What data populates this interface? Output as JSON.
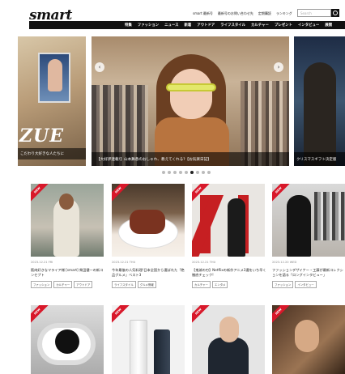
{
  "header": {
    "logo": "smart",
    "top_links": [
      "smart 最新号",
      "最新号のお問い合わせ先",
      "定期購読",
      "ランキング"
    ],
    "search_placeholder": "Search"
  },
  "nav": {
    "items": [
      "特集",
      "ファッション",
      "ニュース",
      "新着",
      "アウトドア",
      "ライフスタイル",
      "カルチャー",
      "プレゼント",
      "インタビュー",
      "展開"
    ]
  },
  "carousel": {
    "left_caption": "こだわり大好きな人たちに",
    "left_big_text": "ZUE",
    "main_caption": "【大好評連載!】山本舞香のおしゃれ、教えてくれる?【お気楽日記】",
    "right_caption": "クリスマスギフト決定版",
    "arrow_left": "‹",
    "arrow_right": "›",
    "dots_total": 9,
    "active_dot": 5
  },
  "articles": [
    {
      "badge": "NEW",
      "date": "2023.12.21 FRI",
      "title": "筋肉好きなマライア様 [smart] 柴田健一の新コンセプト",
      "tags": [
        "ファッション",
        "カルチャー",
        "アウトドア"
      ]
    },
    {
      "badge": "NEW",
      "date": "2023.12.21 THU",
      "title": "今年最後の人気料理!日本全国から選ばれた「絶品グルメ」ベスト3",
      "tags": [
        "ライフスタイル",
        "グルメ情報"
      ]
    },
    {
      "badge": "NEW",
      "date": "2023.12.21 THU",
      "title": "【鬼滅の刃】Netflixの新作アニメ3選をいち早く徹底チェック!",
      "tags": [
        "カルチャー",
        "エンタメ"
      ]
    },
    {
      "badge": "NEW",
      "date": "2023.12.20 WED",
      "title": "ファッションデザイナー・工藤が最新コレクションを語る「ロングインタビュー」",
      "tags": [
        "ファッション",
        "インタビュー"
      ]
    }
  ],
  "articles_row2": [
    {
      "badge": "NEW"
    },
    {
      "badge": "NEW"
    },
    {
      "badge": "NEW"
    },
    {
      "badge": "NEW"
    }
  ]
}
